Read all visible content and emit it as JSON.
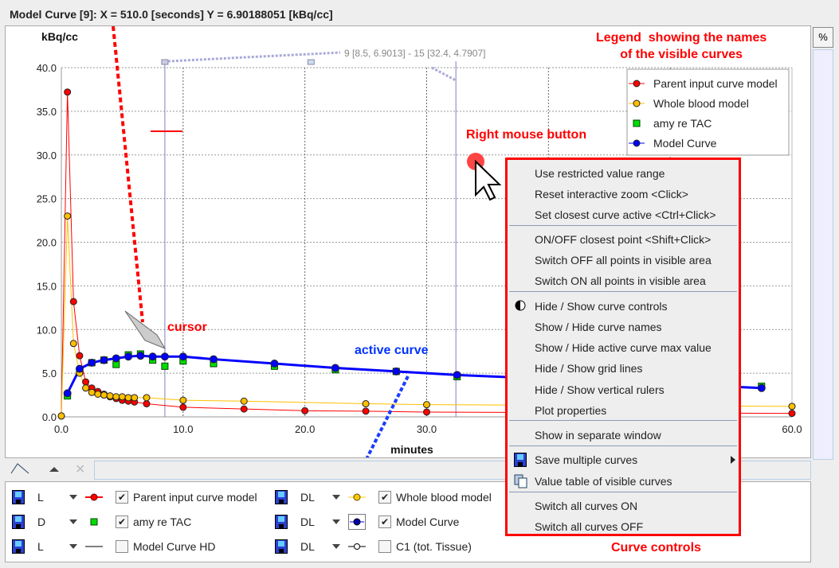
{
  "header": {
    "title": "Model Curve [9]:  X = 510.0 [seconds] Y = 6.90188051 [kBq/cc]"
  },
  "side": {
    "percent_label": "%"
  },
  "chart_data": {
    "type": "scatter",
    "ylabel": "kBq/cc",
    "xlabel": "minutes",
    "xlim": [
      0,
      60
    ],
    "ylim": [
      0,
      40
    ],
    "xticks": [
      "0.0",
      "10.0",
      "20.0",
      "30.0",
      "40.0",
      "50.0",
      "60.0"
    ],
    "yticks": [
      "0.0",
      "5.0",
      "10.0",
      "15.0",
      "20.0",
      "25.0",
      "30.0",
      "35.0",
      "40.0"
    ],
    "grid": true,
    "legend_position": "top-right",
    "ruler_label": "9 [8.5, 6.9013] - 15 [32.4, 4.7907]",
    "rulers": [
      8.5,
      32.4
    ],
    "series": [
      {
        "name": "Parent input curve model",
        "color": "#ff0000",
        "marker": "circle",
        "x": [
          0,
          0.5,
          1,
          1.5,
          2,
          2.5,
          3,
          3.5,
          4,
          4.5,
          5,
          5.5,
          6,
          7,
          10,
          15,
          20,
          25,
          30,
          60
        ],
        "y": [
          0.1,
          37.2,
          13.2,
          7,
          4,
          3.3,
          2.9,
          2.6,
          2.3,
          2.1,
          1.9,
          1.8,
          1.7,
          1.5,
          1.1,
          0.9,
          0.7,
          0.65,
          0.55,
          0.4
        ]
      },
      {
        "name": "Whole blood model",
        "color": "#ffc000",
        "marker": "circle",
        "x": [
          0,
          0.5,
          1,
          1.5,
          2,
          2.5,
          3,
          3.5,
          4,
          4.5,
          5,
          5.5,
          6,
          7,
          10,
          15,
          25,
          30,
          60
        ],
        "y": [
          0.1,
          23,
          8.4,
          5,
          3.3,
          2.8,
          2.6,
          2.5,
          2.4,
          2.3,
          2.3,
          2.2,
          2.2,
          2.2,
          1.9,
          1.8,
          1.5,
          1.4,
          1.2
        ]
      },
      {
        "name": "amy re TAC",
        "color": "#00dd00",
        "marker": "square",
        "x": [
          0.5,
          1.5,
          2.5,
          3.5,
          4.5,
          5.5,
          6.5,
          7.5,
          8.5,
          10,
          12.5,
          17.5,
          22.5,
          27.5,
          32.5,
          57.5
        ],
        "y": [
          2.4,
          5.3,
          6.2,
          6.5,
          6,
          7.1,
          7.2,
          6.5,
          5.8,
          6.4,
          6.1,
          5.8,
          5.4,
          5.2,
          4.6,
          3.5
        ]
      },
      {
        "name": "Model Curve",
        "color": "#0000ff",
        "marker": "circle",
        "x": [
          0.5,
          1.5,
          2.5,
          3.5,
          4.5,
          5.5,
          6.5,
          7.5,
          8.5,
          10,
          12.5,
          17.5,
          22.5,
          27.5,
          32.5,
          57.5
        ],
        "y": [
          2.7,
          5.5,
          6.2,
          6.5,
          6.7,
          6.9,
          7,
          6.9,
          6.9,
          6.9,
          6.6,
          6.1,
          5.6,
          5.2,
          4.8,
          3.3
        ]
      }
    ]
  },
  "annotations": {
    "legend_note": "Legend  showing the names\nof the visible curves",
    "right_mouse": "Right mouse button",
    "cursor": "cursor",
    "active_curve": "active curve",
    "curve_controls": "Curve controls"
  },
  "controls": [
    {
      "mode": "L",
      "name": "Parent input curve model",
      "checked": true,
      "sym": "red-circle"
    },
    {
      "mode": "DL",
      "name": "Whole blood model",
      "checked": true,
      "sym": "yellow-circle"
    },
    {
      "mode": "D",
      "name": "amy re TAC",
      "checked": true,
      "sym": "green-square"
    },
    {
      "mode": "DL",
      "name": "Model Curve",
      "checked": true,
      "sym": "blue-circle"
    },
    {
      "mode": "L",
      "name": "Model Curve HD",
      "checked": false,
      "sym": "black-line"
    },
    {
      "mode": "DL",
      "name": "C1 (tot. Tissue)",
      "checked": false,
      "sym": "white-circle"
    }
  ],
  "menu": {
    "items": [
      "Use restricted value range",
      "Reset interactive zoom <Click>",
      "Set closest curve active <Ctrl+Click>",
      "ON/OFF closest point <Shift+Click>",
      "Switch OFF all points in visible area",
      "Switch ON all points in visible area",
      "Hide / Show curve controls",
      "Show / Hide curve names",
      "Show / Hide active curve max value",
      "Hide / Show grid lines",
      "Hide / Show vertical rulers",
      "Plot properties",
      "Show in separate window",
      "Save multiple curves",
      "Value table of visible curves",
      "Switch all curves ON",
      "Switch all curves OFF"
    ]
  }
}
